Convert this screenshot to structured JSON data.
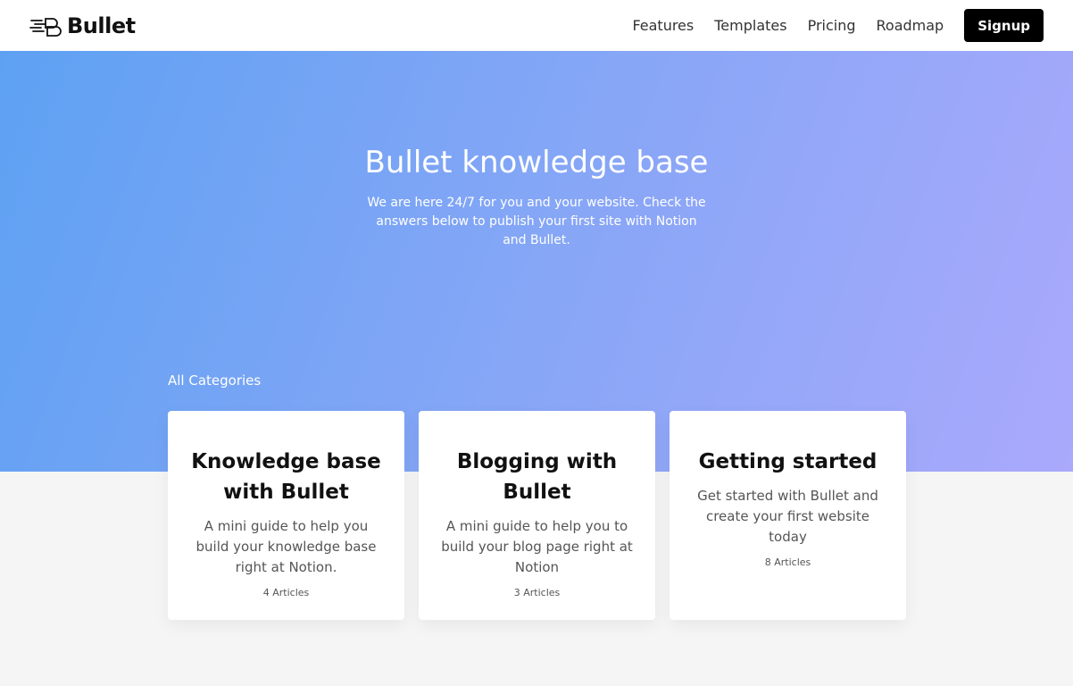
{
  "header": {
    "brand": "Bullet",
    "nav": [
      "Features",
      "Templates",
      "Pricing",
      "Roadmap"
    ],
    "signup_label": "Signup"
  },
  "hero": {
    "title": "Bullet knowledge base",
    "subtitle": "We are here 24/7 for you and your website. Check the answers below to publish your first site with Notion and Bullet."
  },
  "categories": {
    "label": "All Categories",
    "items": [
      {
        "title": "Knowledge base with Bullet",
        "description": "A mini guide to help you build your knowledge base right at Notion.",
        "count": "4 Articles"
      },
      {
        "title": "Blogging with Bullet",
        "description": "A mini guide to help you to build your blog page right at Notion",
        "count": "3 Articles"
      },
      {
        "title": "Getting started",
        "description": "Get started with Bullet and create your first website today",
        "count": "8 Articles"
      }
    ]
  },
  "colors": {
    "gradient_start": "#5ea1f3",
    "gradient_end": "#aaa9fc",
    "signup_bg": "#000000",
    "page_bg": "#f5f5f5"
  }
}
